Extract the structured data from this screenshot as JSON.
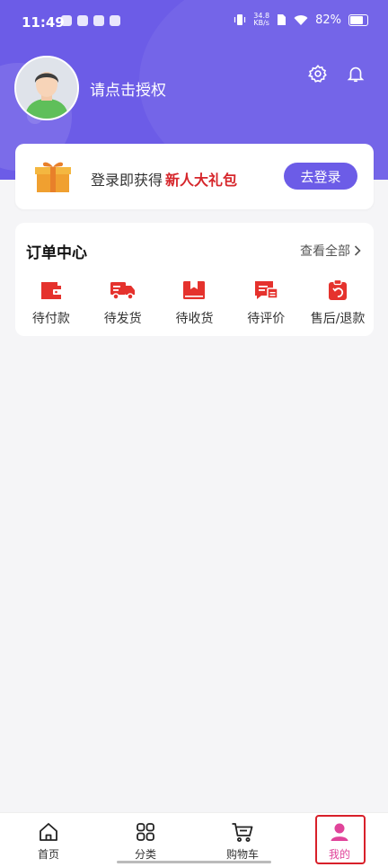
{
  "status_bar": {
    "time": "11:49",
    "speed_value": "34.8",
    "speed_unit": "KB/s",
    "battery": "82%"
  },
  "profile": {
    "prompt": "请点击授权"
  },
  "promo": {
    "text": "登录即获得",
    "highlight": "新人大礼包",
    "login_button": "去登录"
  },
  "orders": {
    "title": "订单中心",
    "view_all": "查看全部",
    "items": [
      {
        "label": "待付款",
        "icon": "wallet-icon"
      },
      {
        "label": "待发货",
        "icon": "delivery-truck-icon"
      },
      {
        "label": "待收货",
        "icon": "package-icon"
      },
      {
        "label": "待评价",
        "icon": "review-icon"
      },
      {
        "label": "售后/退款",
        "icon": "refund-icon"
      }
    ]
  },
  "tabbar": {
    "items": [
      {
        "label": "首页",
        "icon": "home-icon"
      },
      {
        "label": "分类",
        "icon": "category-icon"
      },
      {
        "label": "购物车",
        "icon": "cart-icon"
      },
      {
        "label": "我的",
        "icon": "profile-icon",
        "active": true
      }
    ]
  },
  "colors": {
    "brand": "#6c5ce7",
    "accent_red": "#d6262b",
    "active_tab": "#e0449a"
  }
}
